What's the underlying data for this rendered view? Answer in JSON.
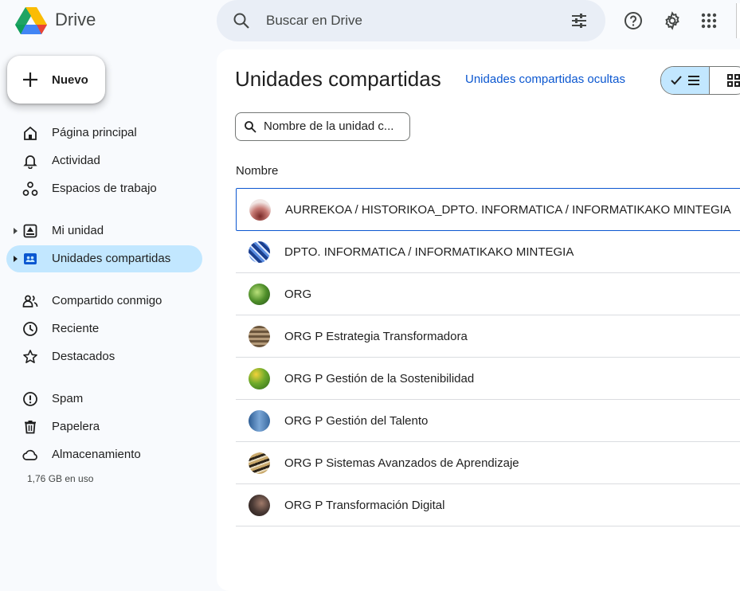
{
  "app": {
    "title": "Drive"
  },
  "search": {
    "placeholder": "Buscar en Drive"
  },
  "new_button": {
    "label": "Nuevo"
  },
  "sidebar": {
    "items": [
      {
        "label": "Página principal",
        "icon": "home-icon"
      },
      {
        "label": "Actividad",
        "icon": "bell-icon"
      },
      {
        "label": "Espacios de trabajo",
        "icon": "workspaces-icon"
      },
      {
        "label": "Mi unidad",
        "icon": "my-drive-icon"
      },
      {
        "label": "Unidades compartidas",
        "icon": "shared-drives-icon",
        "active": true
      },
      {
        "label": "Compartido conmigo",
        "icon": "people-icon"
      },
      {
        "label": "Reciente",
        "icon": "clock-icon"
      },
      {
        "label": "Destacados",
        "icon": "star-icon"
      },
      {
        "label": "Spam",
        "icon": "spam-icon"
      },
      {
        "label": "Papelera",
        "icon": "trash-icon"
      },
      {
        "label": "Almacenamiento",
        "icon": "cloud-icon"
      }
    ],
    "storage_used": "1,76 GB en uso"
  },
  "main": {
    "title": "Unidades compartidas",
    "hidden_link": "Unidades compartidas ocultas",
    "filter_placeholder": "Nombre de la unidad c...",
    "column_header": "Nombre",
    "drives": [
      {
        "name": "AURREKOA / HISTORIKOA_DPTO. INFORMATICA / INFORMATIKAKO MINTEGIA",
        "thumb_color": "#b7635f"
      },
      {
        "name": "DPTO. INFORMATICA / INFORMATIKAKO MINTEGIA",
        "thumb_color": "#2a5fb8"
      },
      {
        "name": "ORG",
        "thumb_color": "#4f8f2a"
      },
      {
        "name": "ORG P Estrategia Transformadora",
        "thumb_color": "#8a7055"
      },
      {
        "name": "ORG P Gestión de la Sostenibilidad",
        "thumb_color": "#6eaa2a"
      },
      {
        "name": "ORG P Gestión del Talento",
        "thumb_color": "#4a7bb0"
      },
      {
        "name": "ORG P Sistemas Avanzados de Aprendizaje",
        "thumb_color": "#6b5b3a"
      },
      {
        "name": "ORG P Transformación Digital",
        "thumb_color": "#4a3a35"
      }
    ]
  },
  "colors": {
    "accent": "#0b57d0",
    "active_bg": "#c2e7ff",
    "search_bg": "#e9eef6"
  }
}
